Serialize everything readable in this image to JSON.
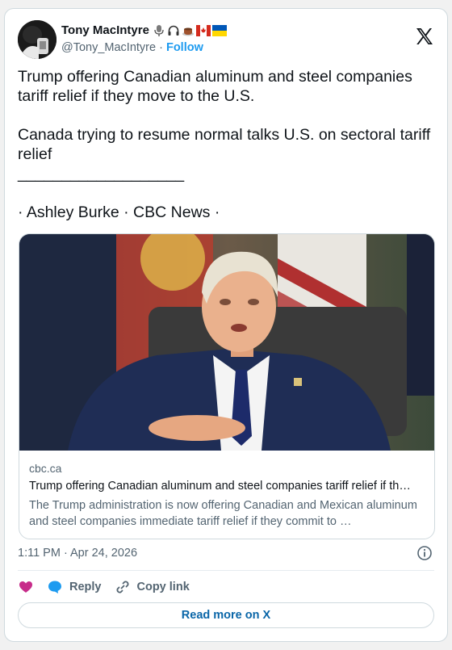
{
  "author": {
    "name": "Tony MacIntyre",
    "handle": "@Tony_MacIntyre",
    "separator": " · ",
    "follow_label": "Follow"
  },
  "tweet": {
    "paragraph1": "Trump offering Canadian aluminum and steel companies tariff relief if they move to the U.S.",
    "paragraph2": "Canada trying to resume normal talks U.S. on sectoral tariff relief",
    "rule_line": "___________________",
    "byline": "· Ashley Burke  · CBC News ·"
  },
  "link_card": {
    "domain": "cbc.ca",
    "title": "Trump offering Canadian aluminum and steel companies tariff relief if th…",
    "description": "The Trump administration is now offering Canadian and Mexican aluminum and steel companies immediate tariff relief if they commit to …"
  },
  "timestamp": "1:11 PM · Apr 24, 2026",
  "actions": {
    "reply_label": "Reply",
    "copy_link_label": "Copy link"
  },
  "read_more_label": "Read more on X",
  "colors": {
    "accent": "#1d9bf0",
    "like_heart": "#f91880",
    "text_primary": "#0f1419",
    "text_secondary": "#536471"
  },
  "icons": [
    "x-logo-icon",
    "microphone-icon",
    "headphones-icon",
    "coffee-icon",
    "canada-flag-icon",
    "ukraine-flag-icon",
    "heart-icon",
    "reply-bubble-icon",
    "link-icon",
    "info-icon"
  ]
}
